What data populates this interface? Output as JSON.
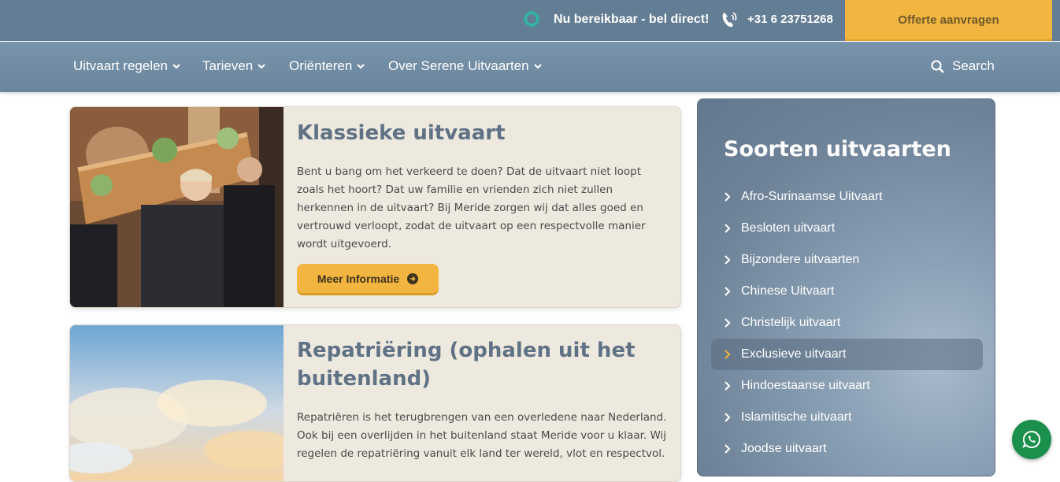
{
  "topbar": {
    "status": "Nu bereikbaar - bel direct!",
    "phone": "+31 6 23751268",
    "cta": "Offerte aanvragen"
  },
  "nav": {
    "items": [
      {
        "label": "Uitvaart regelen"
      },
      {
        "label": "Tarieven"
      },
      {
        "label": "Oriënteren"
      },
      {
        "label": "Over Serene Uitvaarten"
      }
    ],
    "search": "Search"
  },
  "cards": [
    {
      "title": "Klassieke uitvaart",
      "text": "Bent u bang om het verkeerd te doen? Dat de uitvaart niet loopt zoals het hoort? Dat uw familie en vrienden zich niet zullen herkennen in de uitvaart? Bij Meride zorgen wij dat alles goed en vertrouwd verloopt, zodat de uitvaart op een respectvolle manier wordt uitgevoerd.",
      "button": "Meer Informatie"
    },
    {
      "title_line1": "Repatriëring (ophalen uit het",
      "title_line2": "buitenland)",
      "text": "Repatriëren is het terugbrengen van een overledene naar Nederland. Ook bij een overlijden in het buitenland staat Meride voor u klaar. Wij regelen de repatriëring vanuit elk land ter wereld, vlot en respectvol."
    }
  ],
  "sidebar": {
    "title": "Soorten uitvaarten",
    "items": [
      {
        "label": "Afro-Surinaamse Uitvaart"
      },
      {
        "label": "Besloten uitvaart"
      },
      {
        "label": "Bijzondere uitvaarten"
      },
      {
        "label": "Chinese Uitvaart"
      },
      {
        "label": "Christelijk uitvaart"
      },
      {
        "label": "Exclusieve uitvaart"
      },
      {
        "label": "Hindoestaanse uitvaart"
      },
      {
        "label": "Islamitische uitvaart"
      },
      {
        "label": "Joodse uitvaart"
      }
    ]
  },
  "colors": {
    "topbar": "#637d94",
    "accent": "#f2b53f",
    "title": "#5f7285",
    "whatsapp": "#1b8f4c"
  }
}
